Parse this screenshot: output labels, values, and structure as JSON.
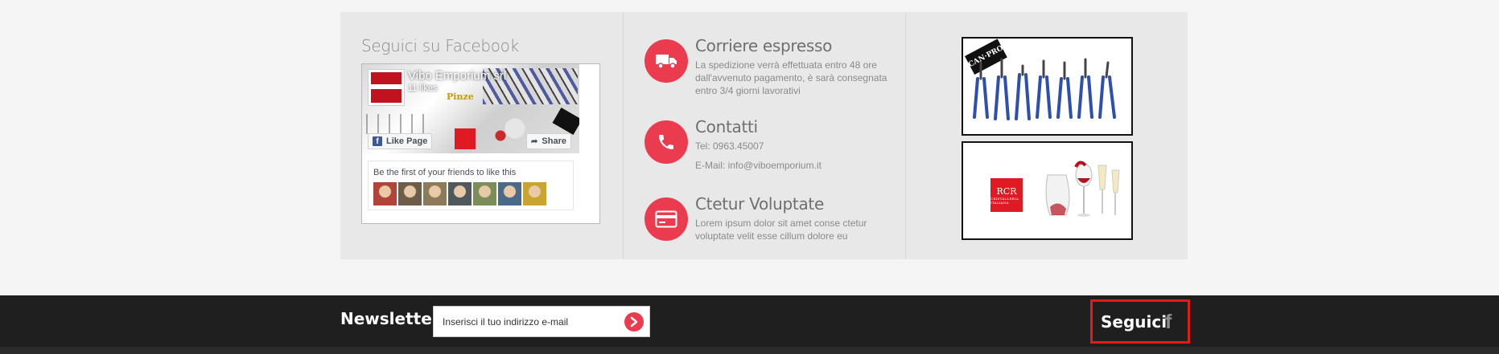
{
  "facebook_widget": {
    "heading": "Seguici su Facebook",
    "page_name": "Vibo Emporium srl",
    "likes": "11 likes",
    "cover_text": "Pinze",
    "cover_brand": "CAN",
    "like_button": "Like Page",
    "share_button": "Share",
    "friends_text": "Be the first of your friends to like this",
    "friend_avatar_colors": [
      "#b0443a",
      "#6d5c48",
      "#8c7a5a",
      "#50585e",
      "#7a8d5a",
      "#4a6a8a",
      "#c9a430"
    ]
  },
  "features": [
    {
      "icon": "truck-icon",
      "title": "Corriere espresso",
      "lines": [
        "La spedizione verrà effettuata entro 48 ore",
        "dall'avvenuto pagamento, è sarà consegnata",
        "entro 3/4 giorni lavorativi"
      ]
    },
    {
      "icon": "phone-icon",
      "title": "Contatti",
      "phone": "Tel: 0963.45007",
      "email": "E-Mail: info@viboemporium.it"
    },
    {
      "icon": "credit-card-icon",
      "title": "Ctetur Voluptate",
      "lines": [
        "Lorem ipsum dolor sit amet conse ctetur",
        "voluptate velit esse cillum dolore eu"
      ]
    }
  ],
  "product_images": {
    "tools_brand": "CAN·PRO",
    "glass_brand": "RCR",
    "glass_brand_sub": "CRISTALLERIA ITALIANA"
  },
  "footer": {
    "newsletter_label": "Newsletter",
    "email_placeholder": "Inserisci il tuo indirizzo e-mail",
    "follow_label": "Seguici",
    "facebook_glyph": "f"
  },
  "colors": {
    "accent": "#ea3c4e",
    "footer_bg": "#1f1f1f",
    "panel_bg": "#e8e8e8",
    "highlight_border": "#e11a1a",
    "facebook_blue": "#3b5998"
  }
}
